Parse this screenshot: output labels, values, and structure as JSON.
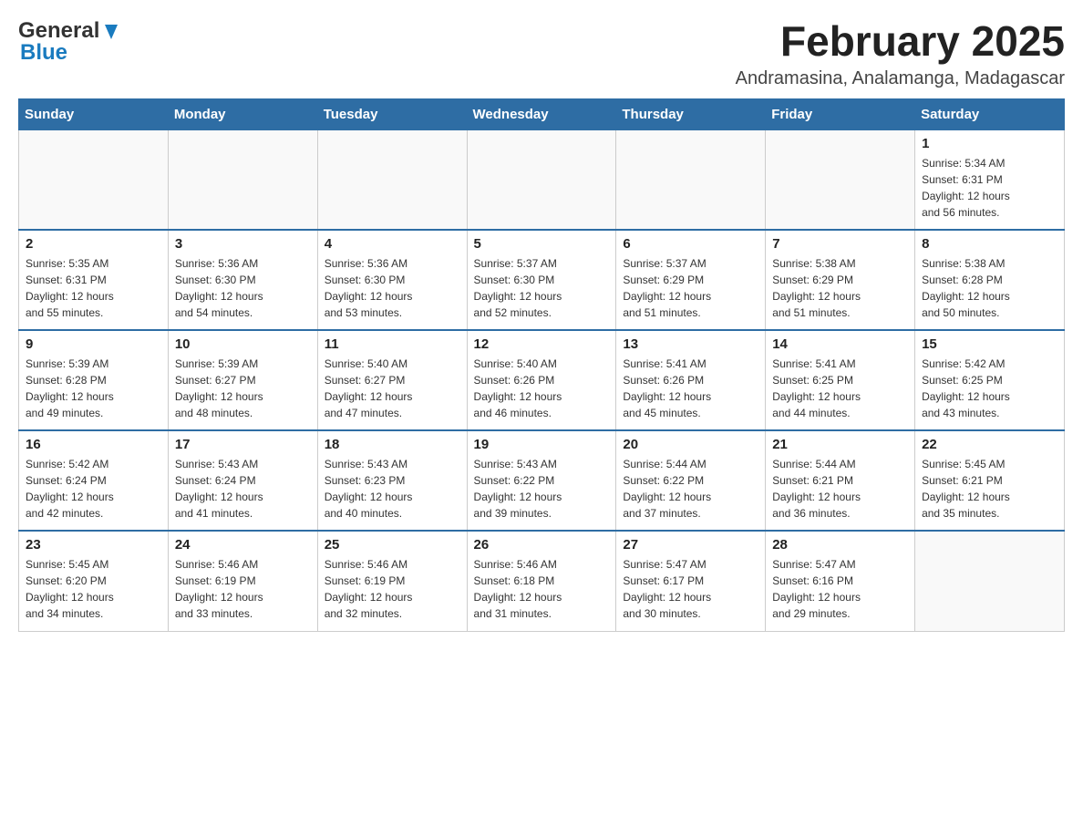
{
  "header": {
    "logo": {
      "general": "General",
      "blue": "Blue",
      "alt": "GeneralBlue logo"
    },
    "title": "February 2025",
    "location": "Andramasina, Analamanga, Madagascar"
  },
  "calendar": {
    "days_of_week": [
      "Sunday",
      "Monday",
      "Tuesday",
      "Wednesday",
      "Thursday",
      "Friday",
      "Saturday"
    ],
    "weeks": [
      {
        "days": [
          {
            "date": "",
            "info": ""
          },
          {
            "date": "",
            "info": ""
          },
          {
            "date": "",
            "info": ""
          },
          {
            "date": "",
            "info": ""
          },
          {
            "date": "",
            "info": ""
          },
          {
            "date": "",
            "info": ""
          },
          {
            "date": "1",
            "info": "Sunrise: 5:34 AM\nSunset: 6:31 PM\nDaylight: 12 hours\nand 56 minutes."
          }
        ]
      },
      {
        "days": [
          {
            "date": "2",
            "info": "Sunrise: 5:35 AM\nSunset: 6:31 PM\nDaylight: 12 hours\nand 55 minutes."
          },
          {
            "date": "3",
            "info": "Sunrise: 5:36 AM\nSunset: 6:30 PM\nDaylight: 12 hours\nand 54 minutes."
          },
          {
            "date": "4",
            "info": "Sunrise: 5:36 AM\nSunset: 6:30 PM\nDaylight: 12 hours\nand 53 minutes."
          },
          {
            "date": "5",
            "info": "Sunrise: 5:37 AM\nSunset: 6:30 PM\nDaylight: 12 hours\nand 52 minutes."
          },
          {
            "date": "6",
            "info": "Sunrise: 5:37 AM\nSunset: 6:29 PM\nDaylight: 12 hours\nand 51 minutes."
          },
          {
            "date": "7",
            "info": "Sunrise: 5:38 AM\nSunset: 6:29 PM\nDaylight: 12 hours\nand 51 minutes."
          },
          {
            "date": "8",
            "info": "Sunrise: 5:38 AM\nSunset: 6:28 PM\nDaylight: 12 hours\nand 50 minutes."
          }
        ]
      },
      {
        "days": [
          {
            "date": "9",
            "info": "Sunrise: 5:39 AM\nSunset: 6:28 PM\nDaylight: 12 hours\nand 49 minutes."
          },
          {
            "date": "10",
            "info": "Sunrise: 5:39 AM\nSunset: 6:27 PM\nDaylight: 12 hours\nand 48 minutes."
          },
          {
            "date": "11",
            "info": "Sunrise: 5:40 AM\nSunset: 6:27 PM\nDaylight: 12 hours\nand 47 minutes."
          },
          {
            "date": "12",
            "info": "Sunrise: 5:40 AM\nSunset: 6:26 PM\nDaylight: 12 hours\nand 46 minutes."
          },
          {
            "date": "13",
            "info": "Sunrise: 5:41 AM\nSunset: 6:26 PM\nDaylight: 12 hours\nand 45 minutes."
          },
          {
            "date": "14",
            "info": "Sunrise: 5:41 AM\nSunset: 6:25 PM\nDaylight: 12 hours\nand 44 minutes."
          },
          {
            "date": "15",
            "info": "Sunrise: 5:42 AM\nSunset: 6:25 PM\nDaylight: 12 hours\nand 43 minutes."
          }
        ]
      },
      {
        "days": [
          {
            "date": "16",
            "info": "Sunrise: 5:42 AM\nSunset: 6:24 PM\nDaylight: 12 hours\nand 42 minutes."
          },
          {
            "date": "17",
            "info": "Sunrise: 5:43 AM\nSunset: 6:24 PM\nDaylight: 12 hours\nand 41 minutes."
          },
          {
            "date": "18",
            "info": "Sunrise: 5:43 AM\nSunset: 6:23 PM\nDaylight: 12 hours\nand 40 minutes."
          },
          {
            "date": "19",
            "info": "Sunrise: 5:43 AM\nSunset: 6:22 PM\nDaylight: 12 hours\nand 39 minutes."
          },
          {
            "date": "20",
            "info": "Sunrise: 5:44 AM\nSunset: 6:22 PM\nDaylight: 12 hours\nand 37 minutes."
          },
          {
            "date": "21",
            "info": "Sunrise: 5:44 AM\nSunset: 6:21 PM\nDaylight: 12 hours\nand 36 minutes."
          },
          {
            "date": "22",
            "info": "Sunrise: 5:45 AM\nSunset: 6:21 PM\nDaylight: 12 hours\nand 35 minutes."
          }
        ]
      },
      {
        "days": [
          {
            "date": "23",
            "info": "Sunrise: 5:45 AM\nSunset: 6:20 PM\nDaylight: 12 hours\nand 34 minutes."
          },
          {
            "date": "24",
            "info": "Sunrise: 5:46 AM\nSunset: 6:19 PM\nDaylight: 12 hours\nand 33 minutes."
          },
          {
            "date": "25",
            "info": "Sunrise: 5:46 AM\nSunset: 6:19 PM\nDaylight: 12 hours\nand 32 minutes."
          },
          {
            "date": "26",
            "info": "Sunrise: 5:46 AM\nSunset: 6:18 PM\nDaylight: 12 hours\nand 31 minutes."
          },
          {
            "date": "27",
            "info": "Sunrise: 5:47 AM\nSunset: 6:17 PM\nDaylight: 12 hours\nand 30 minutes."
          },
          {
            "date": "28",
            "info": "Sunrise: 5:47 AM\nSunset: 6:16 PM\nDaylight: 12 hours\nand 29 minutes."
          },
          {
            "date": "",
            "info": ""
          }
        ]
      }
    ]
  }
}
